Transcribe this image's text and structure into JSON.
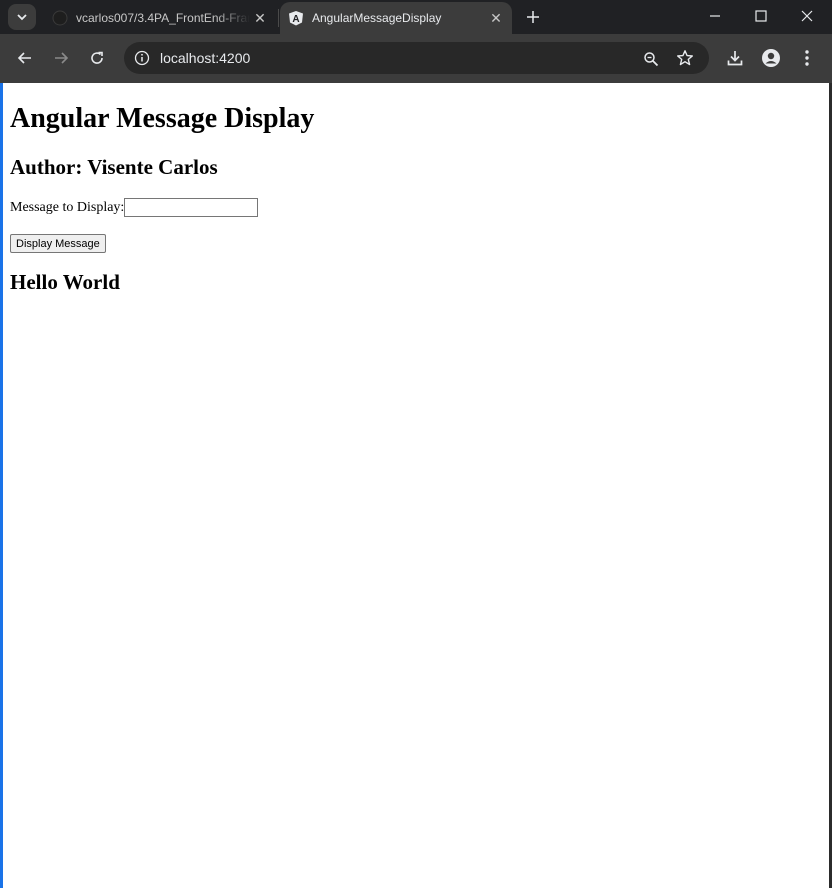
{
  "browser": {
    "tabs": [
      {
        "title": "vcarlos007/3.4PA_FrontEnd-Framework",
        "active": false
      },
      {
        "title": "AngularMessageDisplay",
        "active": true
      }
    ],
    "address": "localhost:4200"
  },
  "page": {
    "heading": "Angular Message Display",
    "author": "Author: Visente Carlos",
    "message_label": "Message to Display:",
    "message_value": "",
    "button_label": "Display Message",
    "output": "Hello World"
  },
  "colors": {
    "tabstrip_bg": "#202124",
    "toolbar_bg": "#3c3c3c",
    "page_bg": "#ffffff"
  }
}
